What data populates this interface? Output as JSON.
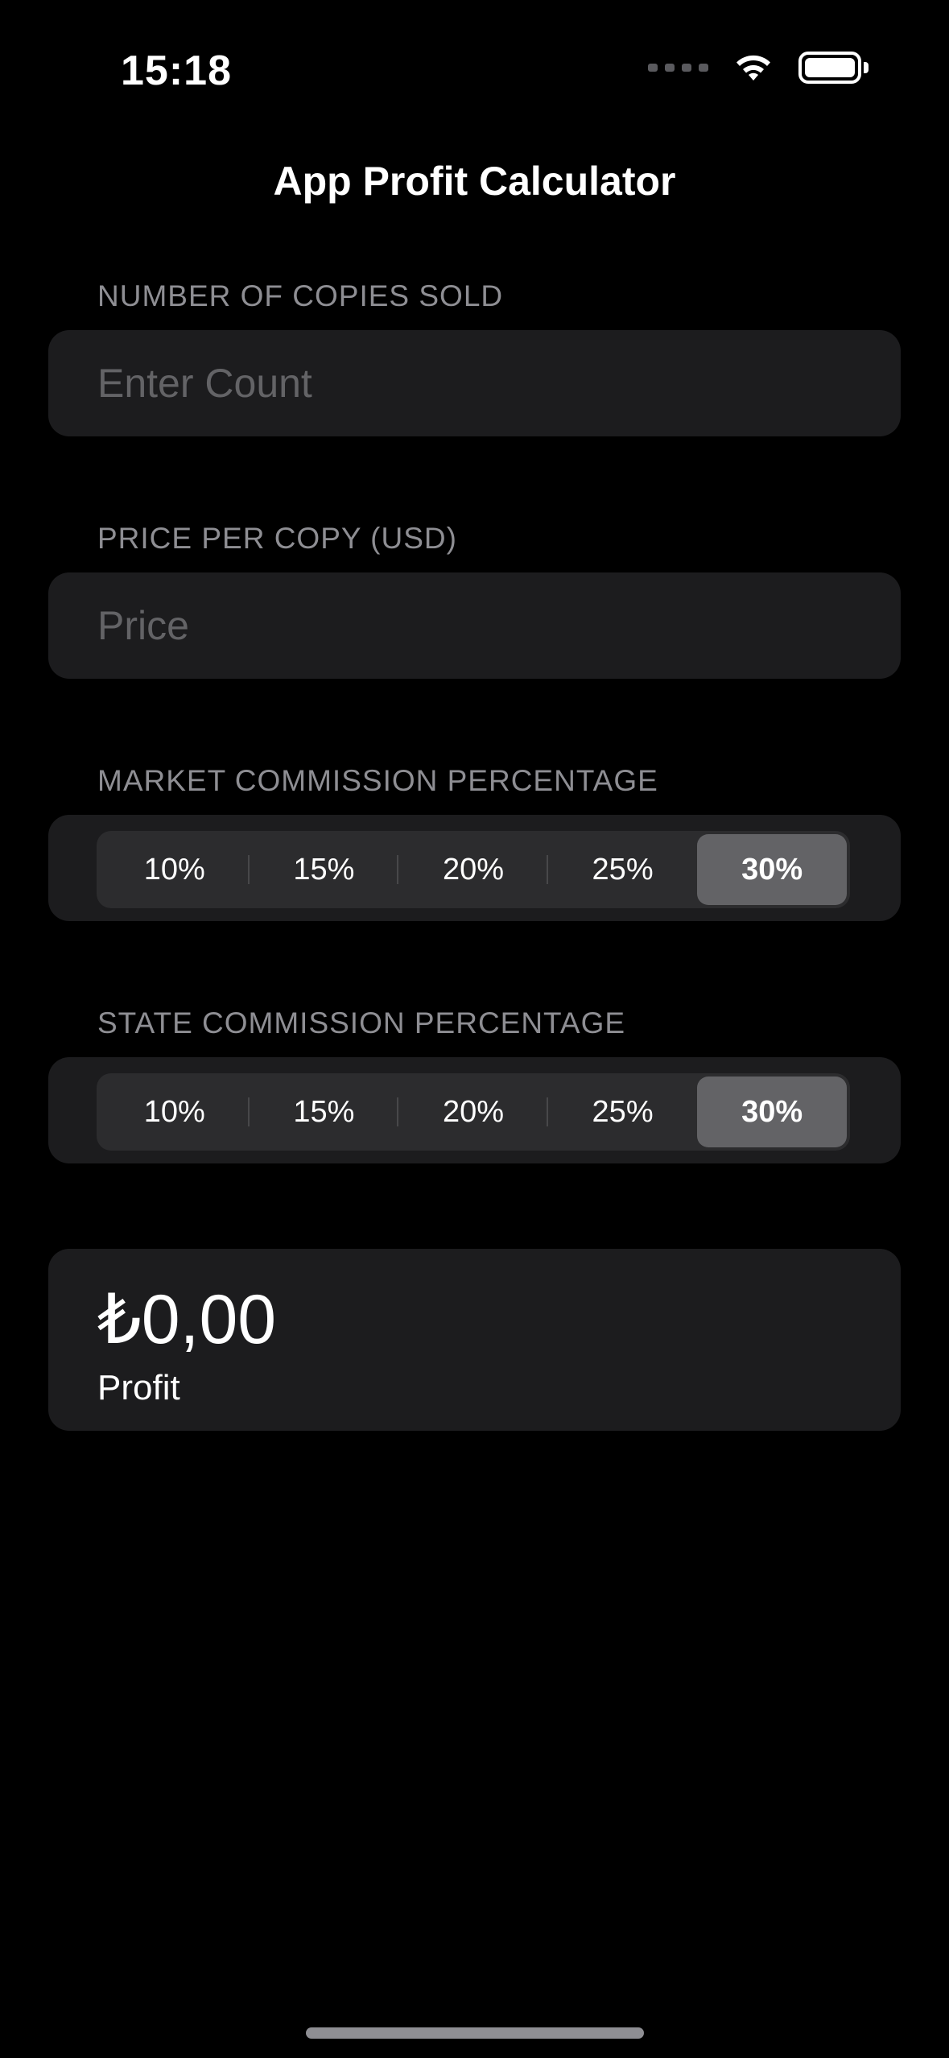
{
  "status_bar": {
    "time": "15:18",
    "icons": [
      "cellular-dots-icon",
      "wifi-icon",
      "battery-icon"
    ]
  },
  "nav": {
    "title": "App Profit Calculator"
  },
  "copies": {
    "label": "NUMBER OF COPIES SOLD",
    "value": "",
    "placeholder": "Enter Count"
  },
  "price": {
    "label": "PRICE PER COPY (USD)",
    "value": "",
    "placeholder": "Price"
  },
  "market_commission": {
    "label": "MARKET COMMISSION PERCENTAGE",
    "options": [
      "10%",
      "15%",
      "20%",
      "25%",
      "30%"
    ],
    "selected": "30%"
  },
  "state_commission": {
    "label": "STATE COMMISSION PERCENTAGE",
    "options": [
      "10%",
      "15%",
      "20%",
      "25%",
      "30%"
    ],
    "selected": "30%"
  },
  "result": {
    "value": "₺0,00",
    "label": "Profit"
  },
  "colors": {
    "background": "#000000",
    "card": "#1c1c1e",
    "segment_track": "#2c2c2e",
    "segment_selected": "#636366",
    "secondary_text": "#8e8e93",
    "placeholder_text": "#636366"
  }
}
